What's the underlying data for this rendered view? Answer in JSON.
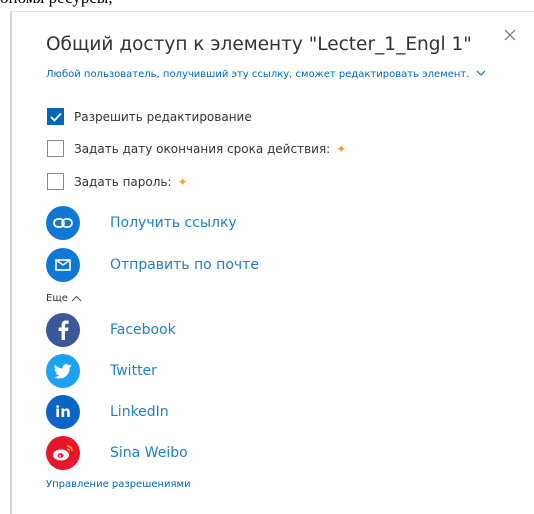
{
  "background": {
    "cut_text": "ономя ресурсы,"
  },
  "dialog": {
    "title": "Общий доступ к элементу \"Lecter_1_Engl 1\"",
    "subtitle": "Любой пользователь, получивший эту ссылку, сможет редактировать элемент.",
    "options": [
      {
        "label": "Разрешить редактирование",
        "checked": true,
        "premium": false
      },
      {
        "label": "Задать дату окончания срока действия:",
        "checked": false,
        "premium": true
      },
      {
        "label": "Задать пароль:",
        "checked": false,
        "premium": true
      }
    ],
    "primary_actions": [
      {
        "label": "Получить ссылку",
        "icon": "link-icon",
        "color": "#0f78d4"
      },
      {
        "label": "Отправить по почте",
        "icon": "mail-icon",
        "color": "#0f78d4"
      }
    ],
    "more_label": "Еще",
    "social_actions": [
      {
        "label": "Facebook",
        "icon": "facebook-icon",
        "color": "#3b5998"
      },
      {
        "label": "Twitter",
        "icon": "twitter-icon",
        "color": "#1da1f2"
      },
      {
        "label": "LinkedIn",
        "icon": "linkedin-icon",
        "color": "#0a66c2"
      },
      {
        "label": "Sina Weibo",
        "icon": "weibo-icon",
        "color": "#e6162d"
      }
    ],
    "manage_link": "Управление разрешениями"
  }
}
